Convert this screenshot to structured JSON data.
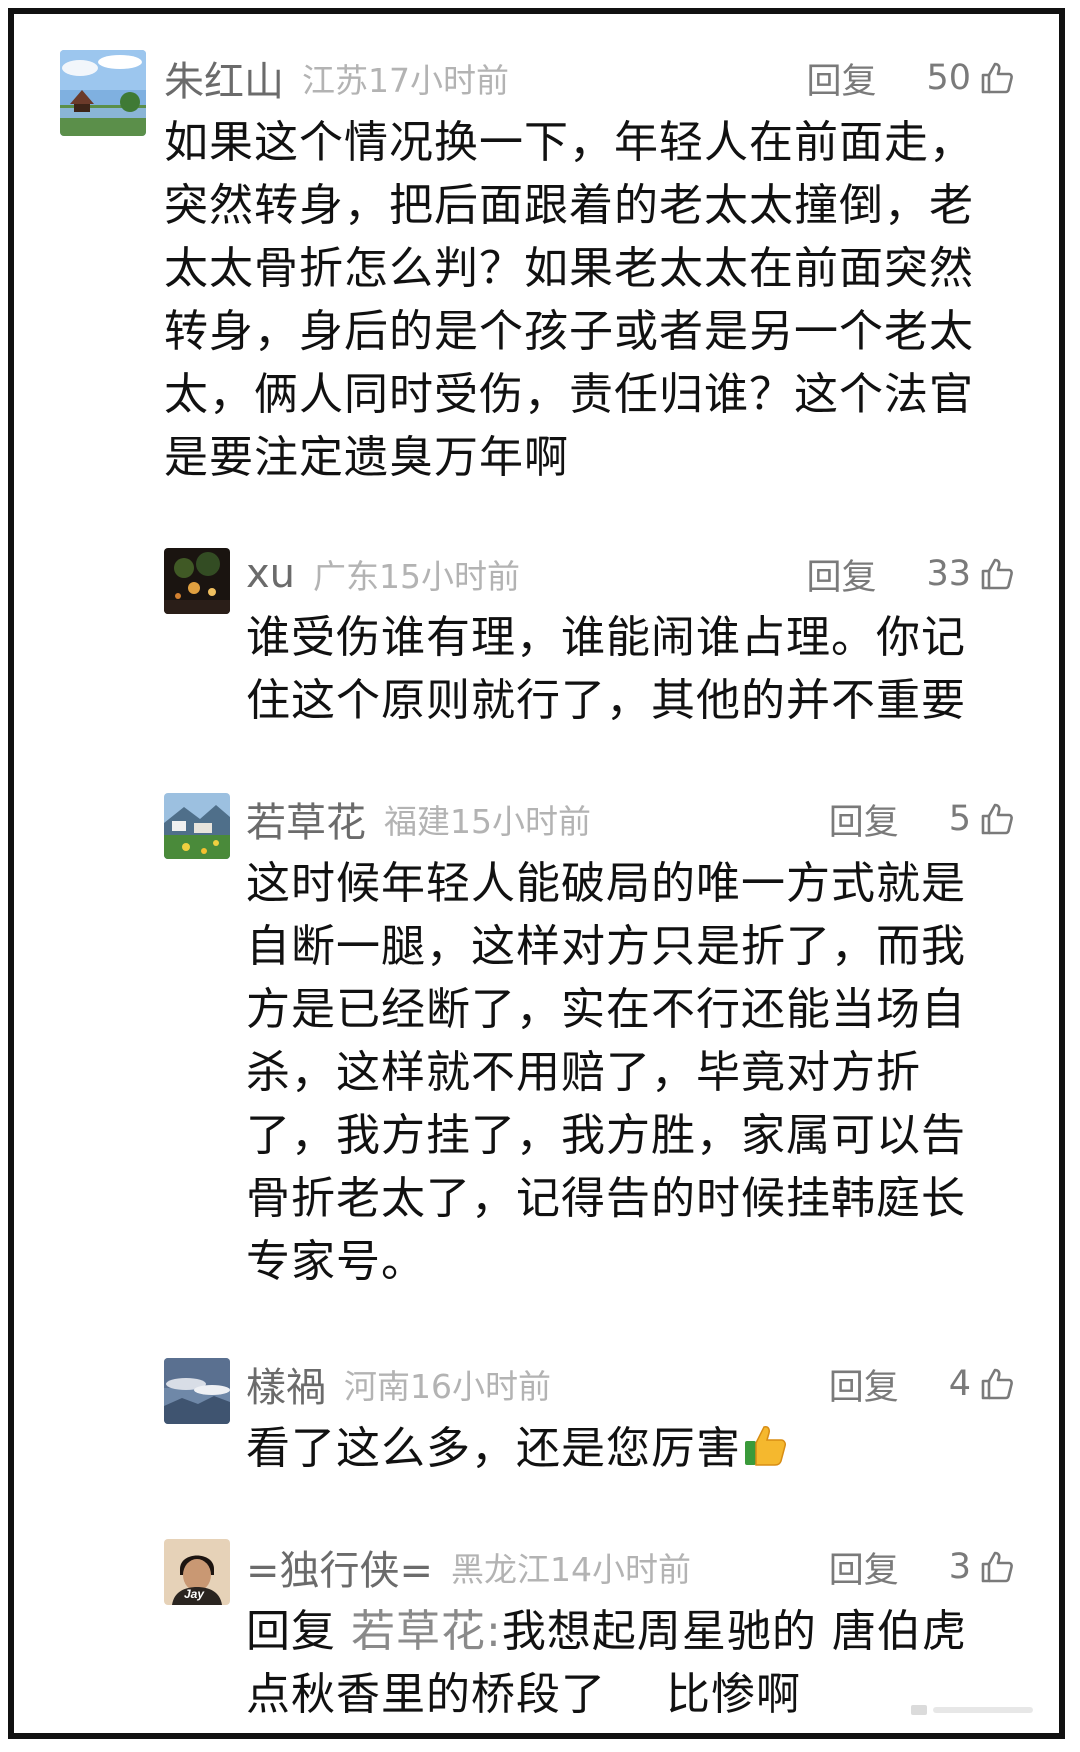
{
  "comments": [
    {
      "user": "朱红山",
      "region": "江苏",
      "time": "17小时前",
      "reply_label": "回复",
      "likes": "50",
      "avatar_icon": "lakeside-pavilion-avatar",
      "lines": [
        "如果这个情况换一下，年轻人在前面走，",
        "突然转身，把后面跟着的老太太撞倒，老",
        "太太骨折怎么判？如果老太太在前面突然",
        "转身，身后的是个孩子或者是另一个老太",
        "太，俩人同时受伤，责任归谁？这个法官",
        "是要注定遗臭万年啊"
      ]
    },
    {
      "user": "xu",
      "region": "广东",
      "time": "15小时前",
      "reply_label": "回复",
      "likes": "33",
      "avatar_icon": "night-lights-avatar",
      "lines": [
        "谁受伤谁有理，谁能闹谁占理。你记",
        "住这个原则就行了，其他的并不重要"
      ]
    },
    {
      "user": "若草花",
      "region": "福建",
      "time": "15小时前",
      "reply_label": "回复",
      "likes": "5",
      "avatar_icon": "mountain-village-avatar",
      "lines": [
        "这时候年轻人能破局的唯一方式就是",
        "自断一腿，这样对方只是折了，而我",
        "方是已经断了，实在不行还能当场自",
        "杀，这样就不用赔了，毕竟对方折",
        "了，我方挂了，我方胜，家属可以告",
        "骨折老太了，记得告的时候挂韩庭长",
        "专家号。"
      ]
    },
    {
      "user": "樣禍",
      "region": "河南",
      "time": "16小时前",
      "reply_label": "回复",
      "likes": "4",
      "avatar_icon": "sky-clouds-avatar",
      "text": "看了这么多，还是您厉害",
      "emoji_icon": "thumbs-up-emoji"
    },
    {
      "user": "=独行侠=",
      "region": "黑龙江",
      "time": "14小时前",
      "reply_label": "回复",
      "likes": "3",
      "avatar_icon": "person-portrait-avatar",
      "avatar_text": "Jay",
      "reply_prefix": "回复",
      "reply_to": "若草花",
      "reply_colon": ":",
      "line1_rest": "我想起周星驰的 唐伯虎",
      "line2": "点秋香里的桥段了    比惨啊"
    }
  ],
  "colors": {
    "username": "#6b6b6b",
    "meta": "#b3b3b3",
    "text": "#111111",
    "border": "#111111"
  }
}
